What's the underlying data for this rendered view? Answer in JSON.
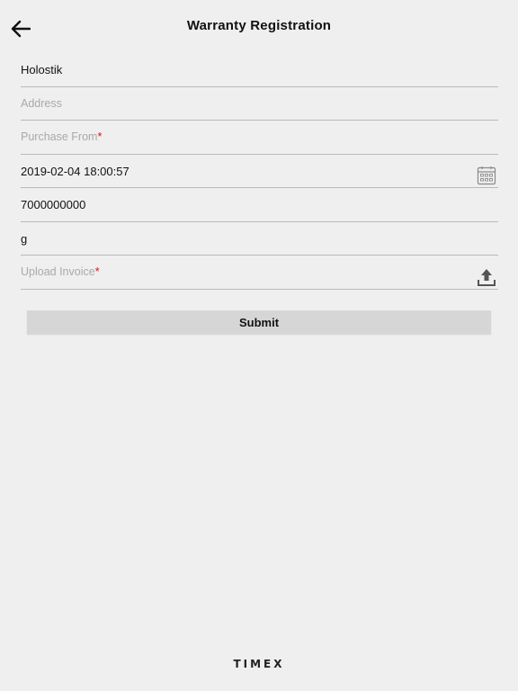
{
  "header": {
    "title": "Warranty Registration",
    "back_icon": "arrow-left-icon"
  },
  "form": {
    "name_value": "Holostik",
    "address_placeholder": "Address",
    "purchase_from_placeholder": "Purchase From",
    "required_mark": "*",
    "purchase_date_value": "2019-02-04 18:00:57",
    "calendar_icon": "calendar-icon",
    "phone_value": "7000000000",
    "extra_value": "g",
    "upload_invoice_placeholder": "Upload Invoice",
    "upload_icon": "upload-icon"
  },
  "actions": {
    "submit_label": "Submit"
  },
  "footer": {
    "brand": "TIMEX"
  },
  "colors": {
    "background": "#efefef",
    "required": "#e01010",
    "submit_bg": "#d6d6d6"
  }
}
